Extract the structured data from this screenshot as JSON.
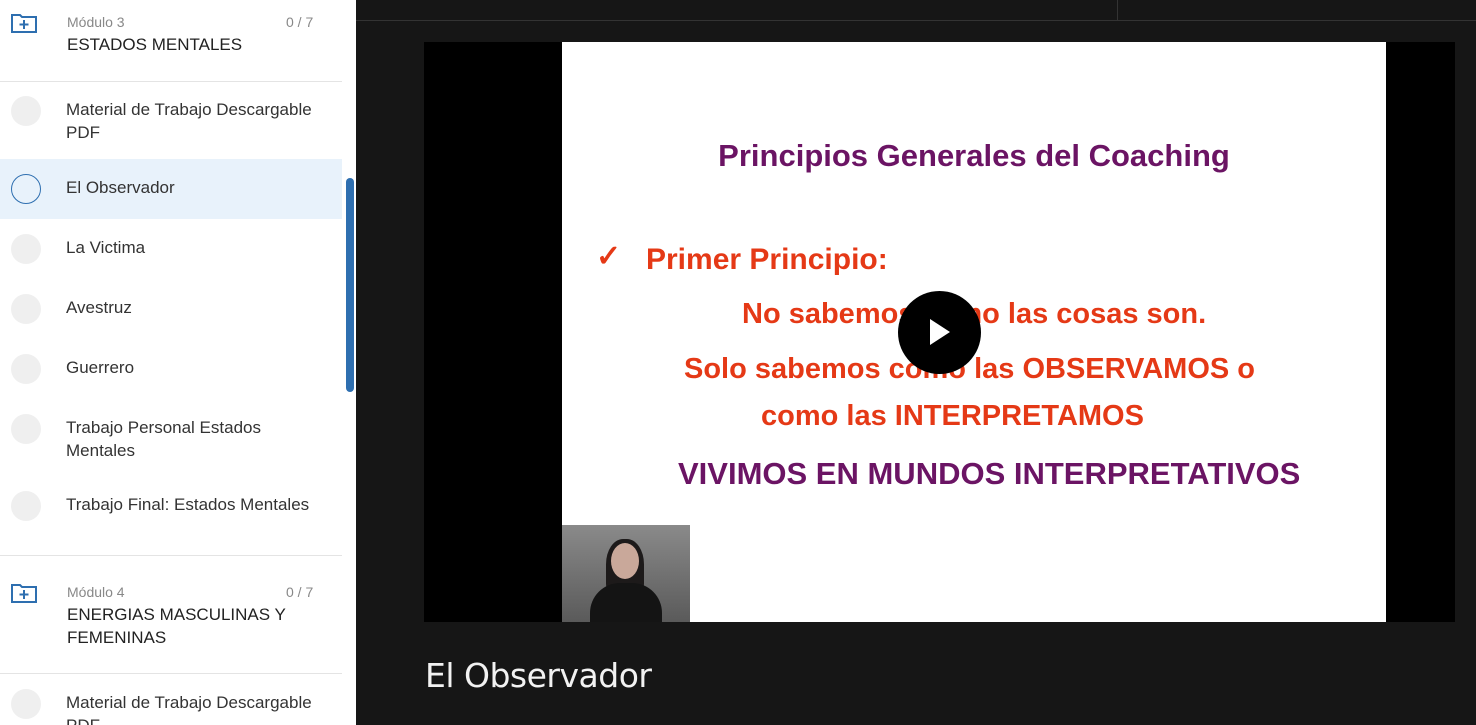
{
  "sidebar": {
    "modules": [
      {
        "number": "Módulo 3",
        "count": "0 / 7",
        "title": "ESTADOS MENTALES"
      },
      {
        "number": "Módulo 4",
        "count": "0 / 7",
        "title": "ENERGIAS MASCULINAS Y FEMENINAS"
      }
    ],
    "lessons": [
      {
        "label": "Material de Trabajo Descargable PDF"
      },
      {
        "label": "El Observador",
        "active": true
      },
      {
        "label": "La Victima"
      },
      {
        "label": "Avestruz"
      },
      {
        "label": "Guerrero"
      },
      {
        "label": "Trabajo Personal Estados Mentales"
      },
      {
        "label": "Trabajo Final: Estados Mentales"
      },
      {
        "label": "Material de Trabajo Descargable PDF"
      }
    ]
  },
  "slide": {
    "title": "Principios Generales del Coaching",
    "check": "✓",
    "principle": "Primer Principio:",
    "line1": "No sabemos como las cosas son.",
    "line2": "Solo sabemos como las OBSERVAMOS o",
    "line3": "como las INTERPRETAMOS",
    "line4": "VIVIMOS EN MUNDOS INTERPRETATIVOS"
  },
  "player": {
    "play_icon": "play-icon"
  },
  "video": {
    "title": "El Observador"
  },
  "colors": {
    "accent": "#2e6fb0",
    "slide_purple": "#6b1464",
    "slide_red": "#e53916",
    "background": "#161616"
  }
}
